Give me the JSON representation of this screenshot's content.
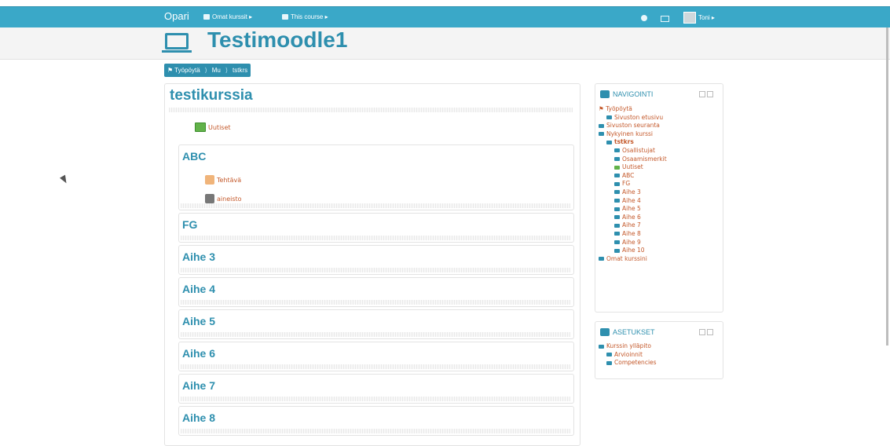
{
  "navbar": {
    "brand": "Opari",
    "my_courses": "Omat kurssit ▸",
    "this_course": "This course ▸",
    "user": "Toni ▸"
  },
  "header": {
    "title": "Testimoodle1"
  },
  "breadcrumb": {
    "home": "Työpöytä",
    "mu": "Mu",
    "course": "tstkrs"
  },
  "course": {
    "title": "testikurssia",
    "news": "Uutiset",
    "sections": [
      {
        "name": "ABC"
      },
      {
        "name": "FG"
      },
      {
        "name": "Aihe 3"
      },
      {
        "name": "Aihe 4"
      },
      {
        "name": "Aihe 5"
      },
      {
        "name": "Aihe 6"
      },
      {
        "name": "Aihe 7"
      },
      {
        "name": "Aihe 8"
      }
    ],
    "abc_activities": [
      {
        "label": "Tehtävä"
      },
      {
        "label": "aineisto"
      }
    ]
  },
  "navigation": {
    "title": "NAVIGOINTI",
    "items": [
      "Työpöytä",
      "Sivuston etusivu",
      "Sivuston seuranta",
      "Nykyinen kurssi",
      "tstkrs",
      "Osallistujat",
      "Osaamismerkit",
      "Uutiset",
      "ABC",
      "FG",
      "Aihe 3",
      "Aihe 4",
      "Aihe 5",
      "Aihe 6",
      "Aihe 7",
      "Aihe 8",
      "Aihe 9",
      "Aihe 10",
      "Omat kurssini"
    ]
  },
  "settings": {
    "title": "ASETUKSET",
    "items": [
      "Kurssin ylläpito",
      "Arvioinnit",
      "Competencies"
    ]
  },
  "colors": {
    "accent": "#2e8fae",
    "navbar": "#3aa8c8",
    "link": "#c4592b"
  }
}
